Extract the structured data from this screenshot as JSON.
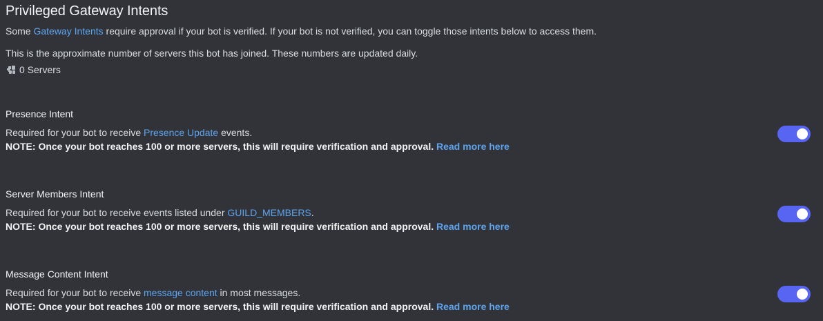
{
  "section": {
    "title": "Privileged Gateway Intents",
    "desc_prefix": "Some ",
    "desc_link": "Gateway Intents",
    "desc_suffix": " require approval if your bot is verified. If your bot is not verified, you can toggle those intents below to access them.",
    "approx_text": "This is the approximate number of servers this bot has joined. These numbers are updated daily.",
    "server_count": "0 Servers",
    "server_icon": "servers-icon"
  },
  "intents": [
    {
      "title": "Presence Intent",
      "desc_prefix": "Required for your bot to receive ",
      "desc_link": "Presence Update",
      "desc_suffix": " events.",
      "note": "NOTE: Once your bot reaches 100 or more servers, this will require verification and approval.",
      "note_link": "Read more here",
      "enabled": true
    },
    {
      "title": "Server Members Intent",
      "desc_prefix": "Required for your bot to receive events listed under ",
      "desc_link": "GUILD_MEMBERS",
      "desc_suffix": ".",
      "note": "NOTE: Once your bot reaches 100 or more servers, this will require verification and approval.",
      "note_link": "Read more here",
      "enabled": true
    },
    {
      "title": "Message Content Intent",
      "desc_prefix": "Required for your bot to receive ",
      "desc_link": "message content",
      "desc_suffix": " in most messages.",
      "note": "NOTE: Once your bot reaches 100 or more servers, this will require verification and approval.",
      "note_link": "Read more here",
      "enabled": true
    }
  ],
  "colors": {
    "background": "#313338",
    "link": "#5ea5ef",
    "toggle_on": "#5865f2"
  }
}
